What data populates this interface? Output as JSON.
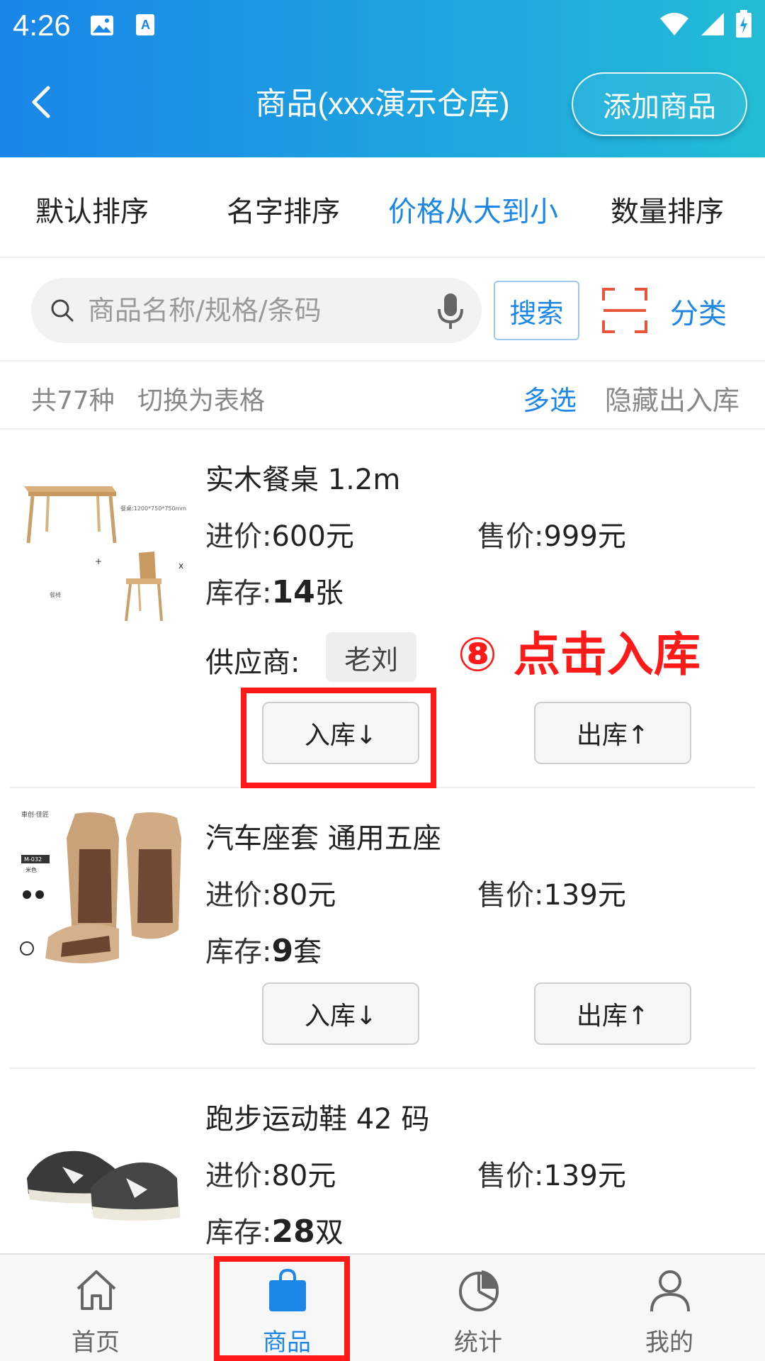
{
  "status_bar": {
    "time": "4:26"
  },
  "header": {
    "title": "商品(xxx演示仓库)",
    "add_button": "添加商品",
    "colors": {
      "gradient_start": "#1a86e8",
      "gradient_end": "#22bcd6"
    }
  },
  "sort": {
    "items": [
      "默认排序",
      "名字排序",
      "价格从大到小",
      "数量排序"
    ],
    "active_index": 2
  },
  "search": {
    "placeholder": "商品名称/规格/条码",
    "button": "搜索",
    "category": "分类"
  },
  "summary": {
    "count": "共77种",
    "toggle": "切换为表格",
    "multi_select": "多选",
    "hide_io": "隐藏出入库"
  },
  "products": [
    {
      "name": "实木餐桌  1.2m",
      "cost_label": "进价:",
      "cost": "600元",
      "price_label": "售价:",
      "price": "999元",
      "stock_label": "库存:",
      "stock": "14",
      "unit": "张",
      "supplier_label": "供应商:",
      "supplier": "老刘",
      "in_button": "入库↓",
      "out_button": "出库↑",
      "image_caption": "餐桌:1200*750*750mm",
      "image_caption2": "餐椅"
    },
    {
      "name": "汽车座套  通用五座",
      "cost_label": "进价:",
      "cost": "80元",
      "price_label": "售价:",
      "price": "139元",
      "stock_label": "库存:",
      "stock": "9",
      "unit": "套",
      "in_button": "入库↓",
      "out_button": "出库↑",
      "image_caption": "M-032",
      "image_caption2": "米色"
    },
    {
      "name": "跑步运动鞋  42 码",
      "cost_label": "进价:",
      "cost": "80元",
      "price_label": "售价:",
      "price": "139元",
      "stock_label": "库存:",
      "stock": "28",
      "unit": "双"
    }
  ],
  "annotation": {
    "text": "⑧ 点击入库",
    "color": "#ff1a1a"
  },
  "bottom_nav": {
    "tabs": [
      "首页",
      "商品",
      "统计",
      "我的"
    ],
    "active_index": 1
  },
  "accent_color": "#1c87e6"
}
